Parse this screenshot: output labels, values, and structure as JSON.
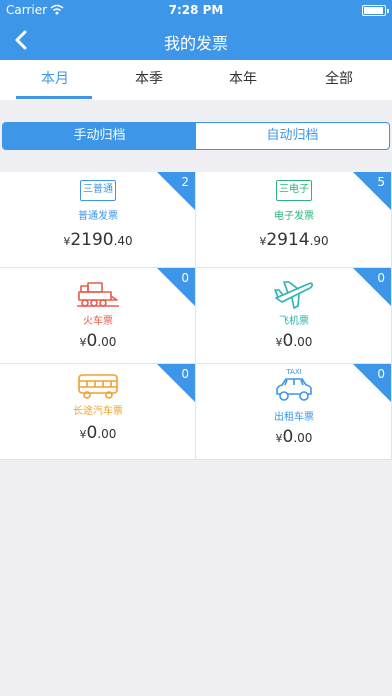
{
  "status_bar": {
    "carrier": "Carrier",
    "time": "7:28 PM",
    "battery_pct": ""
  },
  "nav": {
    "title": "我的发票"
  },
  "tabs": [
    {
      "label": "本月",
      "active": true
    },
    {
      "label": "本季",
      "active": false
    },
    {
      "label": "本年",
      "active": false
    },
    {
      "label": "全部",
      "active": false
    }
  ],
  "segment": [
    {
      "label": "手动归档",
      "active": true
    },
    {
      "label": "自动归档",
      "active": false
    }
  ],
  "invoices": [
    {
      "id": "general",
      "icon_text": "三普通",
      "label": "普通发票",
      "currency": "¥",
      "int": "2190",
      "dec": ".40",
      "count": "2",
      "color": "#3d96e8",
      "icon": "general-invoice-icon"
    },
    {
      "id": "electronic",
      "icon_text": "三电子",
      "label": "电子发票",
      "currency": "¥",
      "int": "2914",
      "dec": ".90",
      "count": "5",
      "color": "#2db37b",
      "icon": "electronic-invoice-icon"
    },
    {
      "id": "train",
      "label": "火车票",
      "currency": "¥",
      "int": "0",
      "dec": ".00",
      "count": "0",
      "color": "#e85b4f",
      "icon": "train-icon"
    },
    {
      "id": "flight",
      "label": "飞机票",
      "currency": "¥",
      "int": "0",
      "dec": ".00",
      "count": "0",
      "color": "#2bb3b3",
      "icon": "airplane-icon"
    },
    {
      "id": "bus",
      "label": "长途汽车票",
      "currency": "¥",
      "int": "0",
      "dec": ".00",
      "count": "0",
      "color": "#f0a030",
      "icon": "bus-icon"
    },
    {
      "id": "taxi",
      "taxi_sign": "TAXI",
      "label": "出租车票",
      "currency": "¥",
      "int": "0",
      "dec": ".00",
      "count": "0",
      "color": "#3d96e8",
      "icon": "taxi-icon"
    }
  ]
}
